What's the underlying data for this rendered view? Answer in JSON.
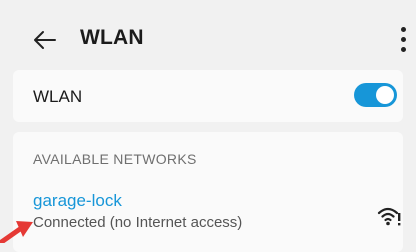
{
  "header": {
    "title": "WLAN",
    "back_icon": "back-arrow-icon",
    "more_icon": "more-vertical-icon"
  },
  "wlan_toggle": {
    "label": "WLAN",
    "enabled": true,
    "color": "#1796d8"
  },
  "networks": {
    "section_title": "AVAILABLE NETWORKS",
    "items": [
      {
        "name": "garage-lock",
        "status": "Connected (no Internet access)",
        "signal_icon": "wifi-no-internet-icon"
      }
    ]
  },
  "colors": {
    "accent": "#1796d8",
    "annotation_arrow": "#e53935",
    "background": "#f1f1f1"
  }
}
